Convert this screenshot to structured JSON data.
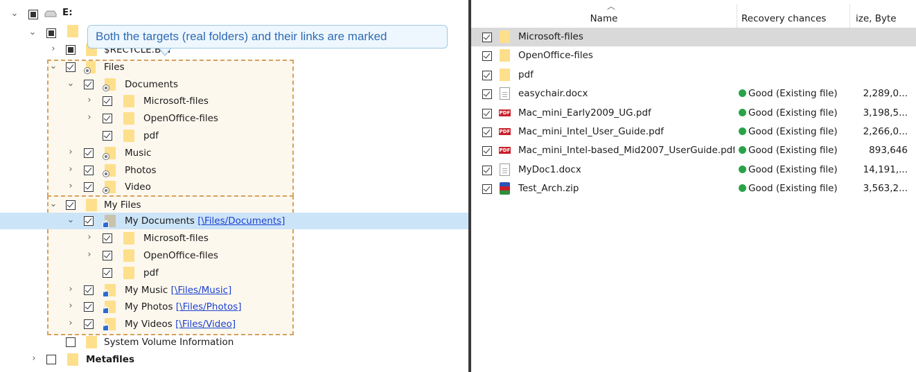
{
  "tree": {
    "drive": {
      "label": "E:"
    },
    "recycle": {
      "label": "$RECYCLE.BIN"
    },
    "files": {
      "label": "Files"
    },
    "documents": {
      "label": "Documents"
    },
    "doc_microsoft": {
      "label": "Microsoft-files"
    },
    "doc_openoffice": {
      "label": "OpenOffice-files"
    },
    "doc_pdf": {
      "label": "pdf"
    },
    "music": {
      "label": "Music"
    },
    "photos": {
      "label": "Photos"
    },
    "video": {
      "label": "Video"
    },
    "myfiles": {
      "label": "My Files"
    },
    "mydocuments": {
      "label": "My Documents",
      "link": "[\\Files/Documents]"
    },
    "my_microsoft": {
      "label": "Microsoft-files"
    },
    "my_openoffice": {
      "label": "OpenOffice-files"
    },
    "my_pdf": {
      "label": "pdf"
    },
    "mymusic": {
      "label": "My Music",
      "link": "[\\Files/Music]"
    },
    "myphotos": {
      "label": "My Photos",
      "link": "[\\Files/Photos]"
    },
    "myvideos": {
      "label": "My Videos",
      "link": "[\\Files/Video]"
    },
    "sysvol": {
      "label": "System Volume Information"
    },
    "metafiles": {
      "label": "Metafiles"
    }
  },
  "callout": {
    "text": "Both the targets (real folders) and their links are marked"
  },
  "list": {
    "headers": {
      "name": "Name",
      "recovery": "Recovery chances",
      "size": "ize, Byte"
    },
    "rows": [
      {
        "name": "Microsoft-files",
        "recovery": "",
        "size": "",
        "icon": "folder-icon",
        "selected": true
      },
      {
        "name": "OpenOffice-files",
        "recovery": "",
        "size": "",
        "icon": "folder-icon"
      },
      {
        "name": "pdf",
        "recovery": "",
        "size": "",
        "icon": "folder-icon"
      },
      {
        "name": "easychair.docx",
        "recovery": "Good (Existing file)",
        "size": "2,289,0...",
        "icon": "document-icon"
      },
      {
        "name": "Mac_mini_Early2009_UG.pdf",
        "recovery": "Good (Existing file)",
        "size": "3,198,5...",
        "icon": "pdf-icon"
      },
      {
        "name": "Mac_mini_Intel_User_Guide.pdf",
        "recovery": "Good (Existing file)",
        "size": "2,266,0...",
        "icon": "pdf-icon"
      },
      {
        "name": "Mac_mini_Intel-based_Mid2007_UserGuide.pdf",
        "recovery": "Good (Existing file)",
        "size": "893,646",
        "icon": "pdf-icon"
      },
      {
        "name": "MyDoc1.docx",
        "recovery": "Good (Existing file)",
        "size": "14,191,...",
        "icon": "document-icon"
      },
      {
        "name": "Test_Arch.zip",
        "recovery": "Good (Existing file)",
        "size": "3,563,2...",
        "icon": "archive-icon"
      }
    ]
  },
  "colors": {
    "selection": "#cce4f7",
    "good": "#2aa348",
    "folder": "#fddf8c",
    "callout_text": "#2f6bb5",
    "dash": "#d4a15e"
  }
}
